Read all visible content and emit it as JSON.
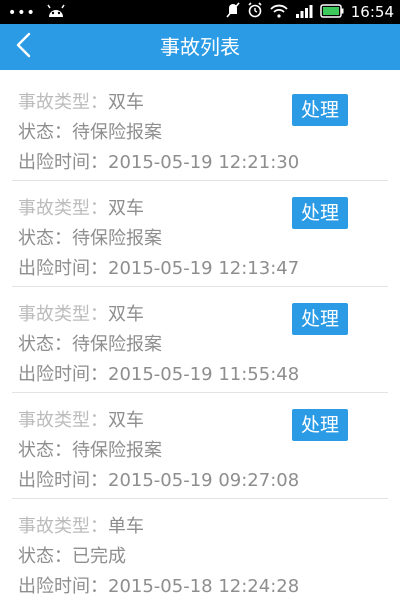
{
  "status_bar": {
    "time": "16:54",
    "icons": [
      "dots-icon",
      "android-icon",
      "mute-icon",
      "alarm-icon",
      "wifi-icon",
      "signal-icon",
      "battery-icon"
    ]
  },
  "header": {
    "title": "事故列表",
    "back_icon": "chevron-left-icon"
  },
  "accidents": [
    {
      "type_label": "事故类型：",
      "type_value": "双车",
      "status": "状态：待保险报案",
      "time": "出险时间：2015-05-19 12:21:30",
      "button": "处理"
    },
    {
      "type_label": "事故类型：",
      "type_value": "双车",
      "status": "状态：待保险报案",
      "time": "出险时间：2015-05-19 12:13:47",
      "button": "处理"
    },
    {
      "type_label": "事故类型：",
      "type_value": "双车",
      "status": "状态：待保险报案",
      "time": "出险时间：2015-05-19 11:55:48",
      "button": "处理"
    },
    {
      "type_label": "事故类型：",
      "type_value": "双车",
      "status": "状态：待保险报案",
      "time": "出险时间：2015-05-19 09:27:08",
      "button": "处理"
    },
    {
      "type_label": "事故类型：",
      "type_value": "单车",
      "status": "状态：已完成",
      "time": "出险时间：2015-05-18 12:24:28"
    }
  ],
  "colors": {
    "accent": "#2b9be5",
    "text_gray": "#8e8e8e",
    "status_bar": "#000000"
  }
}
